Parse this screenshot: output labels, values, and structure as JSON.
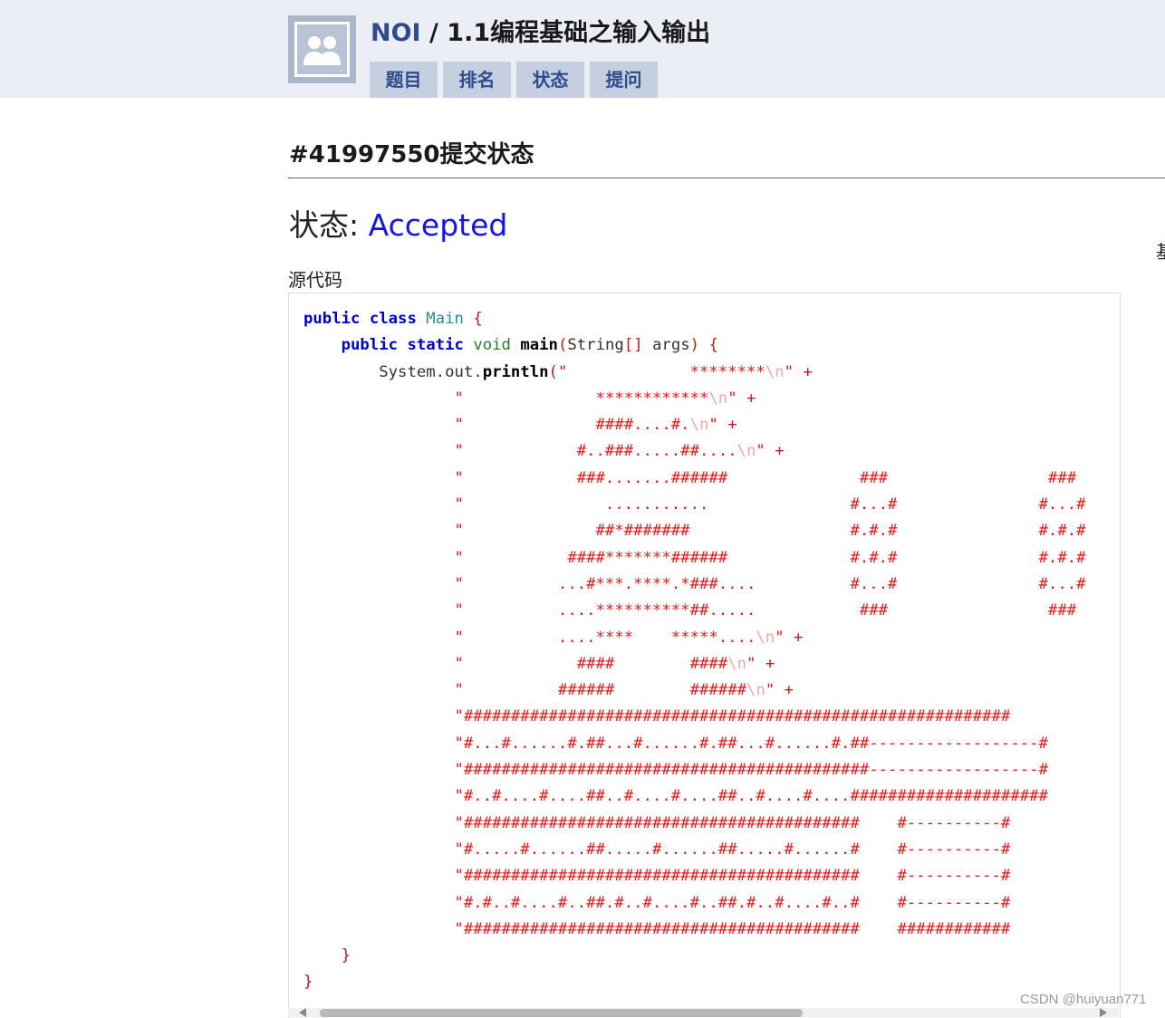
{
  "header": {
    "org": "NOI",
    "separator": " / ",
    "course": "1.1编程基础之输入输出",
    "tabs": [
      "题目",
      "排名",
      "状态",
      "提问"
    ],
    "logo_icon": "group-avatar-icon"
  },
  "page": {
    "title": "#41997550提交状态",
    "status_label": "状态: ",
    "status_value": "Accepted",
    "edge_text": "基",
    "source_label": "源代码"
  },
  "code": {
    "lines": [
      "public class Main {",
      "    public static void main(String[] args) {",
      "        System.out.println(\"             ********\\n\" +",
      "                \"              ************\\n\" +",
      "                \"              ####....#.\\n\" +",
      "                \"            #..###.....##....\\n\" +",
      "                \"            ###.......######              ###                 ###",
      "                \"               ...........               #...#               #...#",
      "                \"              ##*#######                 #.#.#               #.#.#",
      "                \"           ####*******######             #.#.#               #.#.#",
      "                \"          ...#***.****.*###....          #...#               #...#",
      "                \"          ....**********##.....           ###                 ###",
      "                \"          ....****    *****....\\n\" +",
      "                \"            ####        ####\\n\" +",
      "                \"          ######        ######\\n\" +",
      "                \"##########################################################",
      "                \"#...#......#.##...#......#.##...#......#.##------------------#",
      "                \"###########################################------------------#",
      "                \"#..#....#....##..#....#....##..#....#....#####################",
      "                \"##########################################    #----------#",
      "                \"#.....#......##.....#......##.....#......#    #----------#",
      "                \"##########################################    #----------#",
      "                \"#.#..#....#..##.#..#....#..##.#..#....#..#    #----------#",
      "                \"##########################################    ############",
      "    }",
      "}"
    ]
  },
  "watermark": "CSDN @huiyuan771",
  "colors": {
    "header_bg": "#eceef5",
    "tab_bg": "#c6cfe0",
    "nav_text": "#2d4b8d",
    "accepted": "#1414e6",
    "string": "#e01b1b"
  }
}
